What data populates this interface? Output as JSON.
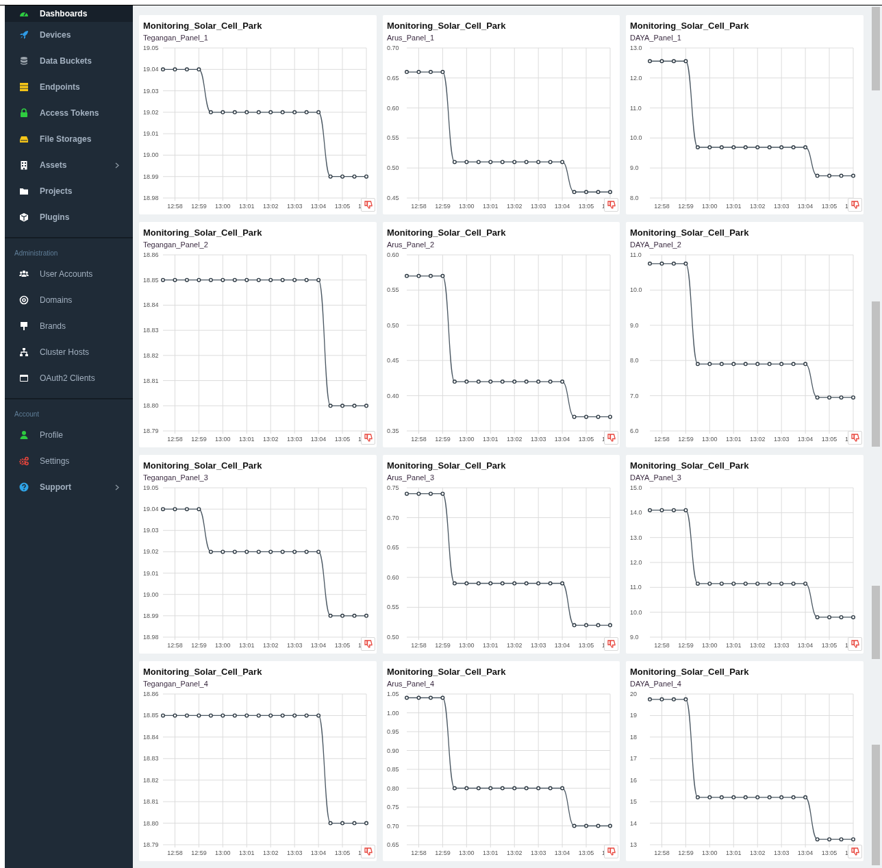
{
  "sidebar": {
    "sections": [
      {
        "items": [
          {
            "label": "Dashboards",
            "selected": true,
            "bold": true,
            "expandable": false
          },
          {
            "label": "Devices",
            "selected": false,
            "bold": true,
            "expandable": false
          },
          {
            "label": "Data Buckets",
            "selected": false,
            "bold": true,
            "expandable": false
          },
          {
            "label": "Endpoints",
            "selected": false,
            "bold": true,
            "expandable": false
          },
          {
            "label": "Access Tokens",
            "selected": false,
            "bold": true,
            "expandable": false
          },
          {
            "label": "File Storages",
            "selected": false,
            "bold": true,
            "expandable": false
          },
          {
            "label": "Assets",
            "selected": false,
            "bold": true,
            "expandable": true
          },
          {
            "label": "Projects",
            "selected": false,
            "bold": true,
            "expandable": false
          },
          {
            "label": "Plugins",
            "selected": false,
            "bold": true,
            "expandable": false
          }
        ]
      },
      {
        "heading": "Administration",
        "items": [
          {
            "label": "User Accounts",
            "selected": false,
            "bold": false,
            "expandable": false
          },
          {
            "label": "Domains",
            "selected": false,
            "bold": false,
            "expandable": false
          },
          {
            "label": "Brands",
            "selected": false,
            "bold": false,
            "expandable": false
          },
          {
            "label": "Cluster Hosts",
            "selected": false,
            "bold": false,
            "expandable": false
          },
          {
            "label": "OAuth2 Clients",
            "selected": false,
            "bold": false,
            "expandable": false
          }
        ]
      },
      {
        "heading": "Account",
        "items": [
          {
            "label": "Profile",
            "selected": false,
            "bold": false,
            "expandable": false
          },
          {
            "label": "Settings",
            "selected": false,
            "bold": false,
            "expandable": false
          },
          {
            "label": "Support",
            "selected": false,
            "bold": true,
            "expandable": true
          }
        ]
      }
    ]
  },
  "cards": [
    {
      "x_label_partial": "1",
      "chart_data": {
        "type": "line",
        "grid": true,
        "title": "Monitoring_Solar_Cell_Park",
        "x": [
          777.5,
          778,
          778.5,
          779,
          779.5,
          780,
          780.5,
          781,
          781.5,
          782,
          782.5,
          783,
          783.5,
          784,
          784.5,
          785,
          785.5,
          786
        ],
        "xlim": [
          777.5,
          786
        ],
        "ylim": [
          18.98,
          19.05
        ],
        "xticks": [
          {
            "value": 778,
            "label": "12:58"
          },
          {
            "value": 779,
            "label": "12:59"
          },
          {
            "value": 780,
            "label": "13:00"
          },
          {
            "value": 781,
            "label": "13:01"
          },
          {
            "value": 782,
            "label": "13:02"
          },
          {
            "value": 783,
            "label": "13:03"
          },
          {
            "value": 784,
            "label": "13:04"
          },
          {
            "value": 785,
            "label": "13:05"
          }
        ],
        "yticks": [
          18.98,
          18.99,
          {
            "value": 19,
            "label": "19.00"
          },
          19.01,
          19.02,
          19.03,
          19.04,
          19.05
        ],
        "series": [
          {
            "name": "Tegangan_Panel_1",
            "color": "#4b5863",
            "marker": true,
            "values": [
              19.04,
              19.04,
              19.04,
              19.04,
              19.02,
              19.02,
              19.02,
              19.02,
              19.02,
              19.02,
              19.02,
              19.02,
              19.02,
              19.02,
              18.99,
              18.99,
              18.99,
              18.99
            ]
          }
        ]
      }
    },
    {
      "x_label_partial": "1",
      "chart_data": {
        "type": "line",
        "grid": true,
        "title": "Monitoring_Solar_Cell_Park",
        "x": [
          777.5,
          778,
          778.5,
          779,
          779.5,
          780,
          780.5,
          781,
          781.5,
          782,
          782.5,
          783,
          783.5,
          784,
          784.5,
          785,
          785.5,
          786
        ],
        "xlim": [
          777.5,
          786
        ],
        "ylim": [
          0.45,
          0.7
        ],
        "xticks": [
          {
            "value": 778,
            "label": "12:58"
          },
          {
            "value": 779,
            "label": "12:59"
          },
          {
            "value": 780,
            "label": "13:00"
          },
          {
            "value": 781,
            "label": "13:01"
          },
          {
            "value": 782,
            "label": "13:02"
          },
          {
            "value": 783,
            "label": "13:03"
          },
          {
            "value": 784,
            "label": "13:04"
          },
          {
            "value": 785,
            "label": "13:05"
          }
        ],
        "yticks": [
          0.45,
          {
            "value": 0.5,
            "label": "0.50"
          },
          0.55,
          {
            "value": 0.6,
            "label": "0.60"
          },
          0.65,
          {
            "value": 0.7,
            "label": "0.70"
          }
        ],
        "series": [
          {
            "name": "Arus_Panel_1",
            "color": "#4b5863",
            "marker": true,
            "values": [
              0.66,
              0.66,
              0.66,
              0.66,
              0.51,
              0.51,
              0.51,
              0.51,
              0.51,
              0.51,
              0.51,
              0.51,
              0.51,
              0.51,
              0.46,
              0.46,
              0.46,
              0.46
            ]
          }
        ]
      }
    },
    {
      "x_label_partial": "1",
      "chart_data": {
        "type": "line",
        "grid": true,
        "title": "Monitoring_Solar_Cell_Park",
        "x": [
          777.5,
          778,
          778.5,
          779,
          779.5,
          780,
          780.5,
          781,
          781.5,
          782,
          782.5,
          783,
          783.5,
          784,
          784.5,
          785,
          785.5,
          786
        ],
        "xlim": [
          777.5,
          786
        ],
        "ylim": [
          8,
          13
        ],
        "xticks": [
          {
            "value": 778,
            "label": "12:58"
          },
          {
            "value": 779,
            "label": "12:59"
          },
          {
            "value": 780,
            "label": "13:00"
          },
          {
            "value": 781,
            "label": "13:01"
          },
          {
            "value": 782,
            "label": "13:02"
          },
          {
            "value": 783,
            "label": "13:03"
          },
          {
            "value": 784,
            "label": "13:04"
          },
          {
            "value": 785,
            "label": "13:05"
          }
        ],
        "yticks": [
          {
            "value": 8,
            "label": "8.0"
          },
          {
            "value": 9,
            "label": "9.0"
          },
          {
            "value": 10,
            "label": "10.0"
          },
          {
            "value": 11,
            "label": "11.0"
          },
          {
            "value": 12,
            "label": "12.0"
          },
          {
            "value": 13,
            "label": "13.0"
          }
        ],
        "series": [
          {
            "name": "DAYA_Panel_1",
            "color": "#4b5863",
            "marker": true,
            "values": [
              12.56,
              12.56,
              12.56,
              12.56,
              9.69,
              9.69,
              9.69,
              9.69,
              9.69,
              9.69,
              9.69,
              9.69,
              9.69,
              9.69,
              8.74,
              8.74,
              8.74,
              8.74
            ]
          }
        ]
      }
    },
    {
      "x_label_partial": "1",
      "chart_data": {
        "type": "line",
        "grid": true,
        "title": "Monitoring_Solar_Cell_Park",
        "x": [
          777.5,
          778,
          778.5,
          779,
          779.5,
          780,
          780.5,
          781,
          781.5,
          782,
          782.5,
          783,
          783.5,
          784,
          784.5,
          785,
          785.5,
          786
        ],
        "xlim": [
          777.5,
          786
        ],
        "ylim": [
          18.79,
          18.86
        ],
        "xticks": [
          {
            "value": 778,
            "label": "12:58"
          },
          {
            "value": 779,
            "label": "12:59"
          },
          {
            "value": 780,
            "label": "13:00"
          },
          {
            "value": 781,
            "label": "13:01"
          },
          {
            "value": 782,
            "label": "13:02"
          },
          {
            "value": 783,
            "label": "13:03"
          },
          {
            "value": 784,
            "label": "13:04"
          },
          {
            "value": 785,
            "label": "13:05"
          }
        ],
        "yticks": [
          18.79,
          {
            "value": 18.8,
            "label": "18.80"
          },
          18.81,
          18.82,
          18.83,
          18.84,
          18.85,
          18.86
        ],
        "series": [
          {
            "name": "Tegangan_Panel_2",
            "color": "#4b5863",
            "marker": true,
            "values": [
              18.85,
              18.85,
              18.85,
              18.85,
              18.85,
              18.85,
              18.85,
              18.85,
              18.85,
              18.85,
              18.85,
              18.85,
              18.85,
              18.85,
              18.8,
              18.8,
              18.8,
              18.8
            ]
          }
        ]
      }
    },
    {
      "x_label_partial": "1",
      "chart_data": {
        "type": "line",
        "grid": true,
        "title": "Monitoring_Solar_Cell_Park",
        "x": [
          777.5,
          778,
          778.5,
          779,
          779.5,
          780,
          780.5,
          781,
          781.5,
          782,
          782.5,
          783,
          783.5,
          784,
          784.5,
          785,
          785.5,
          786
        ],
        "xlim": [
          777.5,
          786
        ],
        "ylim": [
          0.35,
          0.6
        ],
        "xticks": [
          {
            "value": 778,
            "label": "12:58"
          },
          {
            "value": 779,
            "label": "12:59"
          },
          {
            "value": 780,
            "label": "13:00"
          },
          {
            "value": 781,
            "label": "13:01"
          },
          {
            "value": 782,
            "label": "13:02"
          },
          {
            "value": 783,
            "label": "13:03"
          },
          {
            "value": 784,
            "label": "13:04"
          },
          {
            "value": 785,
            "label": "13:05"
          }
        ],
        "yticks": [
          0.35,
          {
            "value": 0.4,
            "label": "0.40"
          },
          0.45,
          {
            "value": 0.5,
            "label": "0.50"
          },
          0.55,
          {
            "value": 0.6,
            "label": "0.60"
          }
        ],
        "series": [
          {
            "name": "Arus_Panel_2",
            "color": "#4b5863",
            "marker": true,
            "values": [
              0.57,
              0.57,
              0.57,
              0.57,
              0.42,
              0.42,
              0.42,
              0.42,
              0.42,
              0.42,
              0.42,
              0.42,
              0.42,
              0.42,
              0.37,
              0.37,
              0.37,
              0.37
            ]
          }
        ]
      }
    },
    {
      "x_label_partial": "1",
      "chart_data": {
        "type": "line",
        "grid": true,
        "title": "Monitoring_Solar_Cell_Park",
        "x": [
          777.5,
          778,
          778.5,
          779,
          779.5,
          780,
          780.5,
          781,
          781.5,
          782,
          782.5,
          783,
          783.5,
          784,
          784.5,
          785,
          785.5,
          786
        ],
        "xlim": [
          777.5,
          786
        ],
        "ylim": [
          6,
          11
        ],
        "xticks": [
          {
            "value": 778,
            "label": "12:58"
          },
          {
            "value": 779,
            "label": "12:59"
          },
          {
            "value": 780,
            "label": "13:00"
          },
          {
            "value": 781,
            "label": "13:01"
          },
          {
            "value": 782,
            "label": "13:02"
          },
          {
            "value": 783,
            "label": "13:03"
          },
          {
            "value": 784,
            "label": "13:04"
          },
          {
            "value": 785,
            "label": "13:05"
          }
        ],
        "yticks": [
          {
            "value": 6,
            "label": "6.0"
          },
          {
            "value": 7,
            "label": "7.0"
          },
          {
            "value": 8,
            "label": "8.0"
          },
          {
            "value": 9,
            "label": "9.0"
          },
          {
            "value": 10,
            "label": "10.0"
          },
          {
            "value": 11,
            "label": "11.0"
          }
        ],
        "series": [
          {
            "name": "DAYA_Panel_2",
            "color": "#4b5863",
            "marker": true,
            "values": [
              10.75,
              10.75,
              10.75,
              10.75,
              7.9,
              7.9,
              7.9,
              7.9,
              7.9,
              7.9,
              7.9,
              7.9,
              7.9,
              7.9,
              6.95,
              6.95,
              6.95,
              6.95
            ]
          }
        ]
      }
    },
    {
      "x_label_partial": "1",
      "chart_data": {
        "type": "line",
        "grid": true,
        "title": "Monitoring_Solar_Cell_Park",
        "x": [
          777.5,
          778,
          778.5,
          779,
          779.5,
          780,
          780.5,
          781,
          781.5,
          782,
          782.5,
          783,
          783.5,
          784,
          784.5,
          785,
          785.5,
          786
        ],
        "xlim": [
          777.5,
          786
        ],
        "ylim": [
          18.98,
          19.05
        ],
        "xticks": [
          {
            "value": 778,
            "label": "12:58"
          },
          {
            "value": 779,
            "label": "12:59"
          },
          {
            "value": 780,
            "label": "13:00"
          },
          {
            "value": 781,
            "label": "13:01"
          },
          {
            "value": 782,
            "label": "13:02"
          },
          {
            "value": 783,
            "label": "13:03"
          },
          {
            "value": 784,
            "label": "13:04"
          },
          {
            "value": 785,
            "label": "13:05"
          }
        ],
        "yticks": [
          18.98,
          18.99,
          {
            "value": 19,
            "label": "19.00"
          },
          19.01,
          19.02,
          19.03,
          19.04,
          19.05
        ],
        "series": [
          {
            "name": "Tegangan_Panel_3",
            "color": "#4b5863",
            "marker": true,
            "values": [
              19.04,
              19.04,
              19.04,
              19.04,
              19.02,
              19.02,
              19.02,
              19.02,
              19.02,
              19.02,
              19.02,
              19.02,
              19.02,
              19.02,
              18.99,
              18.99,
              18.99,
              18.99
            ]
          }
        ]
      }
    },
    {
      "x_label_partial": "1",
      "chart_data": {
        "type": "line",
        "grid": true,
        "title": "Monitoring_Solar_Cell_Park",
        "x": [
          777.5,
          778,
          778.5,
          779,
          779.5,
          780,
          780.5,
          781,
          781.5,
          782,
          782.5,
          783,
          783.5,
          784,
          784.5,
          785,
          785.5,
          786
        ],
        "xlim": [
          777.5,
          786
        ],
        "ylim": [
          0.5,
          0.75
        ],
        "xticks": [
          {
            "value": 778,
            "label": "12:58"
          },
          {
            "value": 779,
            "label": "12:59"
          },
          {
            "value": 780,
            "label": "13:00"
          },
          {
            "value": 781,
            "label": "13:01"
          },
          {
            "value": 782,
            "label": "13:02"
          },
          {
            "value": 783,
            "label": "13:03"
          },
          {
            "value": 784,
            "label": "13:04"
          },
          {
            "value": 785,
            "label": "13:05"
          }
        ],
        "yticks": [
          {
            "value": 0.5,
            "label": "0.50"
          },
          0.55,
          {
            "value": 0.6,
            "label": "0.60"
          },
          0.65,
          {
            "value": 0.7,
            "label": "0.70"
          },
          0.75
        ],
        "series": [
          {
            "name": "Arus_Panel_3",
            "color": "#4b5863",
            "marker": true,
            "values": [
              0.74,
              0.74,
              0.74,
              0.74,
              0.59,
              0.59,
              0.59,
              0.59,
              0.59,
              0.59,
              0.59,
              0.59,
              0.59,
              0.59,
              0.52,
              0.52,
              0.52,
              0.52
            ]
          }
        ]
      }
    },
    {
      "x_label_partial": "1",
      "chart_data": {
        "type": "line",
        "grid": true,
        "title": "Monitoring_Solar_Cell_Park",
        "x": [
          777.5,
          778,
          778.5,
          779,
          779.5,
          780,
          780.5,
          781,
          781.5,
          782,
          782.5,
          783,
          783.5,
          784,
          784.5,
          785,
          785.5,
          786
        ],
        "xlim": [
          777.5,
          786
        ],
        "ylim": [
          9,
          15
        ],
        "xticks": [
          {
            "value": 778,
            "label": "12:58"
          },
          {
            "value": 779,
            "label": "12:59"
          },
          {
            "value": 780,
            "label": "13:00"
          },
          {
            "value": 781,
            "label": "13:01"
          },
          {
            "value": 782,
            "label": "13:02"
          },
          {
            "value": 783,
            "label": "13:03"
          },
          {
            "value": 784,
            "label": "13:04"
          },
          {
            "value": 785,
            "label": "13:05"
          }
        ],
        "yticks": [
          {
            "value": 9,
            "label": "9.0"
          },
          {
            "value": 10,
            "label": "10.0"
          },
          {
            "value": 11,
            "label": "11.0"
          },
          {
            "value": 12,
            "label": "12.0"
          },
          {
            "value": 13,
            "label": "13.0"
          },
          {
            "value": 14,
            "label": "14.0"
          },
          {
            "value": 15,
            "label": "15.0"
          }
        ],
        "series": [
          {
            "name": "DAYA_Panel_3",
            "color": "#4b5863",
            "marker": true,
            "values": [
              14.1,
              14.1,
              14.1,
              14.1,
              11.15,
              11.15,
              11.15,
              11.15,
              11.15,
              11.15,
              11.15,
              11.15,
              11.15,
              11.15,
              9.8,
              9.8,
              9.8,
              9.8
            ]
          }
        ]
      }
    },
    {
      "x_label_partial": "1",
      "chart_data": {
        "type": "line",
        "grid": true,
        "title": "Monitoring_Solar_Cell_Park",
        "x": [
          777.5,
          778,
          778.5,
          779,
          779.5,
          780,
          780.5,
          781,
          781.5,
          782,
          782.5,
          783,
          783.5,
          784,
          784.5,
          785,
          785.5,
          786
        ],
        "xlim": [
          777.5,
          786
        ],
        "ylim": [
          18.79,
          18.86
        ],
        "xticks": [
          {
            "value": 778,
            "label": "12:58"
          },
          {
            "value": 779,
            "label": "12:59"
          },
          {
            "value": 780,
            "label": "13:00"
          },
          {
            "value": 781,
            "label": "13:01"
          },
          {
            "value": 782,
            "label": "13:02"
          },
          {
            "value": 783,
            "label": "13:03"
          },
          {
            "value": 784,
            "label": "13:04"
          },
          {
            "value": 785,
            "label": "13:05"
          }
        ],
        "yticks": [
          18.79,
          {
            "value": 18.8,
            "label": "18.80"
          },
          18.81,
          18.82,
          18.83,
          18.84,
          18.85,
          18.86
        ],
        "series": [
          {
            "name": "Tegangan_Panel_4",
            "color": "#4b5863",
            "marker": true,
            "values": [
              18.85,
              18.85,
              18.85,
              18.85,
              18.85,
              18.85,
              18.85,
              18.85,
              18.85,
              18.85,
              18.85,
              18.85,
              18.85,
              18.85,
              18.8,
              18.8,
              18.8,
              18.8
            ]
          }
        ]
      }
    },
    {
      "x_label_partial": "1",
      "chart_data": {
        "type": "line",
        "grid": true,
        "title": "Monitoring_Solar_Cell_Park",
        "x": [
          777.5,
          778,
          778.5,
          779,
          779.5,
          780,
          780.5,
          781,
          781.5,
          782,
          782.5,
          783,
          783.5,
          784,
          784.5,
          785,
          785.5,
          786
        ],
        "xlim": [
          777.5,
          786
        ],
        "ylim": [
          0.65,
          1.05
        ],
        "xticks": [
          {
            "value": 778,
            "label": "12:58"
          },
          {
            "value": 779,
            "label": "12:59"
          },
          {
            "value": 780,
            "label": "13:00"
          },
          {
            "value": 781,
            "label": "13:01"
          },
          {
            "value": 782,
            "label": "13:02"
          },
          {
            "value": 783,
            "label": "13:03"
          },
          {
            "value": 784,
            "label": "13:04"
          },
          {
            "value": 785,
            "label": "13:05"
          }
        ],
        "yticks": [
          0.65,
          {
            "value": 0.7,
            "label": "0.70"
          },
          0.75,
          {
            "value": 0.8,
            "label": "0.80"
          },
          0.85,
          {
            "value": 0.9,
            "label": "0.90"
          },
          0.95,
          {
            "value": 1,
            "label": "1.00"
          },
          1.05
        ],
        "series": [
          {
            "name": "Arus_Panel_4",
            "color": "#4b5863",
            "marker": true,
            "values": [
              1.04,
              1.04,
              1.04,
              1.04,
              0.8,
              0.8,
              0.8,
              0.8,
              0.8,
              0.8,
              0.8,
              0.8,
              0.8,
              0.8,
              0.7,
              0.7,
              0.7,
              0.7
            ]
          }
        ]
      }
    },
    {
      "x_label_partial": "1",
      "chart_data": {
        "type": "line",
        "grid": true,
        "title": "Monitoring_Solar_Cell_Park",
        "x": [
          777.5,
          778,
          778.5,
          779,
          779.5,
          780,
          780.5,
          781,
          781.5,
          782,
          782.5,
          783,
          783.5,
          784,
          784.5,
          785,
          785.5,
          786
        ],
        "xlim": [
          777.5,
          786
        ],
        "ylim": [
          13,
          20
        ],
        "xticks": [
          {
            "value": 778,
            "label": "12:58"
          },
          {
            "value": 779,
            "label": "12:59"
          },
          {
            "value": 780,
            "label": "13:00"
          },
          {
            "value": 781,
            "label": "13:01"
          },
          {
            "value": 782,
            "label": "13:02"
          },
          {
            "value": 783,
            "label": "13:03"
          },
          {
            "value": 784,
            "label": "13:04"
          },
          {
            "value": 785,
            "label": "13:05"
          }
        ],
        "yticks": [
          13,
          14,
          15,
          16,
          17,
          18,
          19,
          20
        ],
        "series": [
          {
            "name": "DAYA_Panel_4",
            "color": "#4b5863",
            "marker": true,
            "values": [
              19.75,
              19.75,
              19.75,
              19.75,
              15.2,
              15.2,
              15.2,
              15.2,
              15.2,
              15.2,
              15.2,
              15.2,
              15.2,
              15.2,
              13.25,
              13.25,
              13.25,
              13.25
            ]
          }
        ]
      }
    }
  ]
}
